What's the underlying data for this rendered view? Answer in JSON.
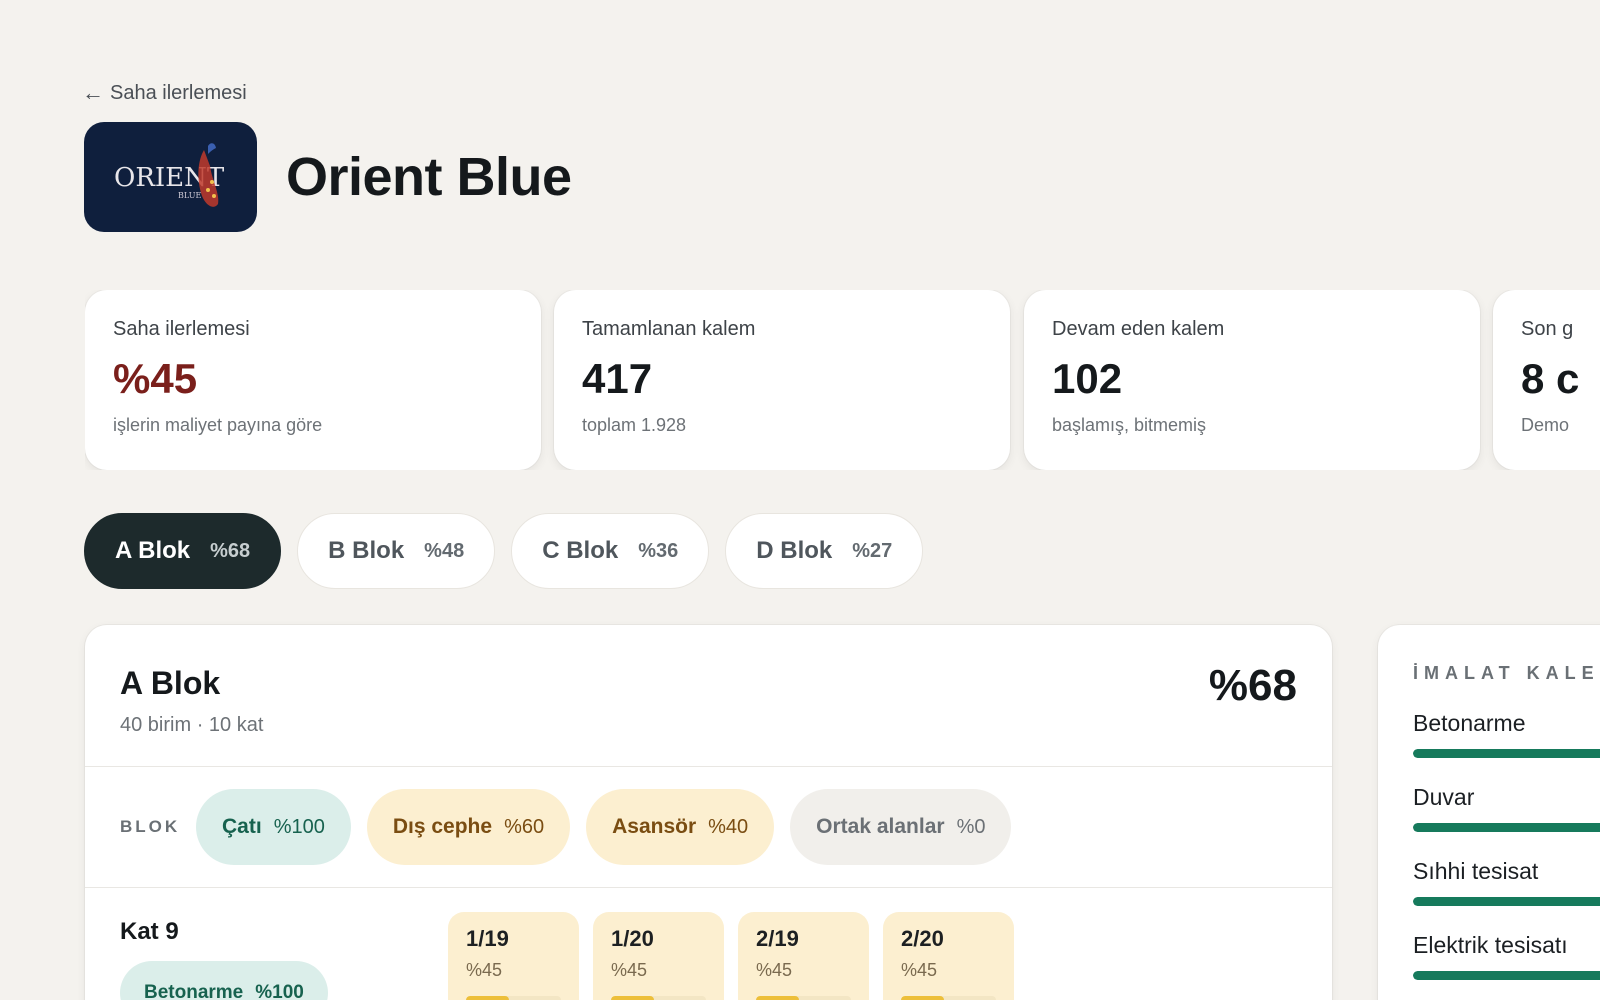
{
  "header": {
    "back_label": "Saha ilerlemesi",
    "title": "Orient Blue",
    "logo_text": "ORIENT",
    "logo_subtext": "BLUE"
  },
  "stats": [
    {
      "label": "Saha ilerlemesi",
      "value": "%45",
      "sub": "işlerin maliyet payına göre"
    },
    {
      "label": "Tamamlanan kalem",
      "value": "417",
      "sub": "toplam 1.928"
    },
    {
      "label": "Devam eden kalem",
      "value": "102",
      "sub": "başlamış, bitmemiş"
    },
    {
      "label": "Son g",
      "value": "8 c",
      "sub": "Demo"
    }
  ],
  "tabs": [
    {
      "name": "A Blok",
      "pct": "%68"
    },
    {
      "name": "B Blok",
      "pct": "%48"
    },
    {
      "name": "C Blok",
      "pct": "%36"
    },
    {
      "name": "D Blok",
      "pct": "%27"
    }
  ],
  "block": {
    "title": "A Blok",
    "sub": "40 birim · 10 kat",
    "pct": "%68",
    "tags_label": "BLOK",
    "tags": [
      {
        "name": "Çatı",
        "pct": "%100"
      },
      {
        "name": "Dış cephe",
        "pct": "%60"
      },
      {
        "name": "Asansör",
        "pct": "%40"
      },
      {
        "name": "Ortak alanlar",
        "pct": "%0"
      }
    ],
    "floor": {
      "name": "Kat 9",
      "pill_name": "Betonarme",
      "pill_pct": "%100",
      "units": [
        {
          "name": "1/19",
          "pct": "%45",
          "progress": 0.45
        },
        {
          "name": "1/20",
          "pct": "%45",
          "progress": 0.45
        },
        {
          "name": "2/19",
          "pct": "%45",
          "progress": 0.45
        },
        {
          "name": "2/20",
          "pct": "%45",
          "progress": 0.45
        }
      ]
    }
  },
  "side": {
    "title": "İMALAT KALEM",
    "items": [
      {
        "name": "Betonarme",
        "progress": 1.0
      },
      {
        "name": "Duvar",
        "progress": 1.0
      },
      {
        "name": "Sıhhi tesisat",
        "progress": 1.0
      },
      {
        "name": "Elektrik tesisatı",
        "progress": 1.0
      }
    ]
  },
  "colors": {
    "accent": "#7a1f1b",
    "active_tab": "#1d2a2c",
    "done": "#167a5c",
    "warn": "#edbf3a"
  }
}
